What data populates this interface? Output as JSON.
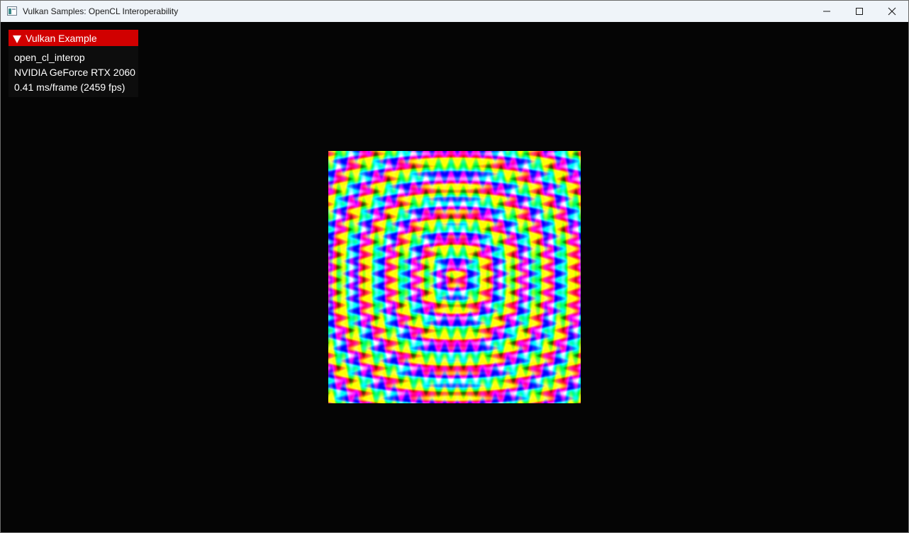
{
  "window": {
    "title": "Vulkan Samples: OpenCL Interoperability",
    "icon": "app-window-icon",
    "controls": {
      "minimize_icon": "minimize-icon",
      "maximize_icon": "maximize-icon",
      "close_icon": "close-icon"
    }
  },
  "overlay": {
    "header_title": "Vulkan Example",
    "collapse_icon": "triangle-down-icon",
    "header_color": "#d10000",
    "lines": [
      "open_cl_interop",
      "NVIDIA GeForce RTX 2060",
      "0.41 ms/frame (2459 fps)"
    ]
  },
  "render": {
    "background_color": "#050505",
    "pattern": "concentric-rainbow-rings"
  }
}
